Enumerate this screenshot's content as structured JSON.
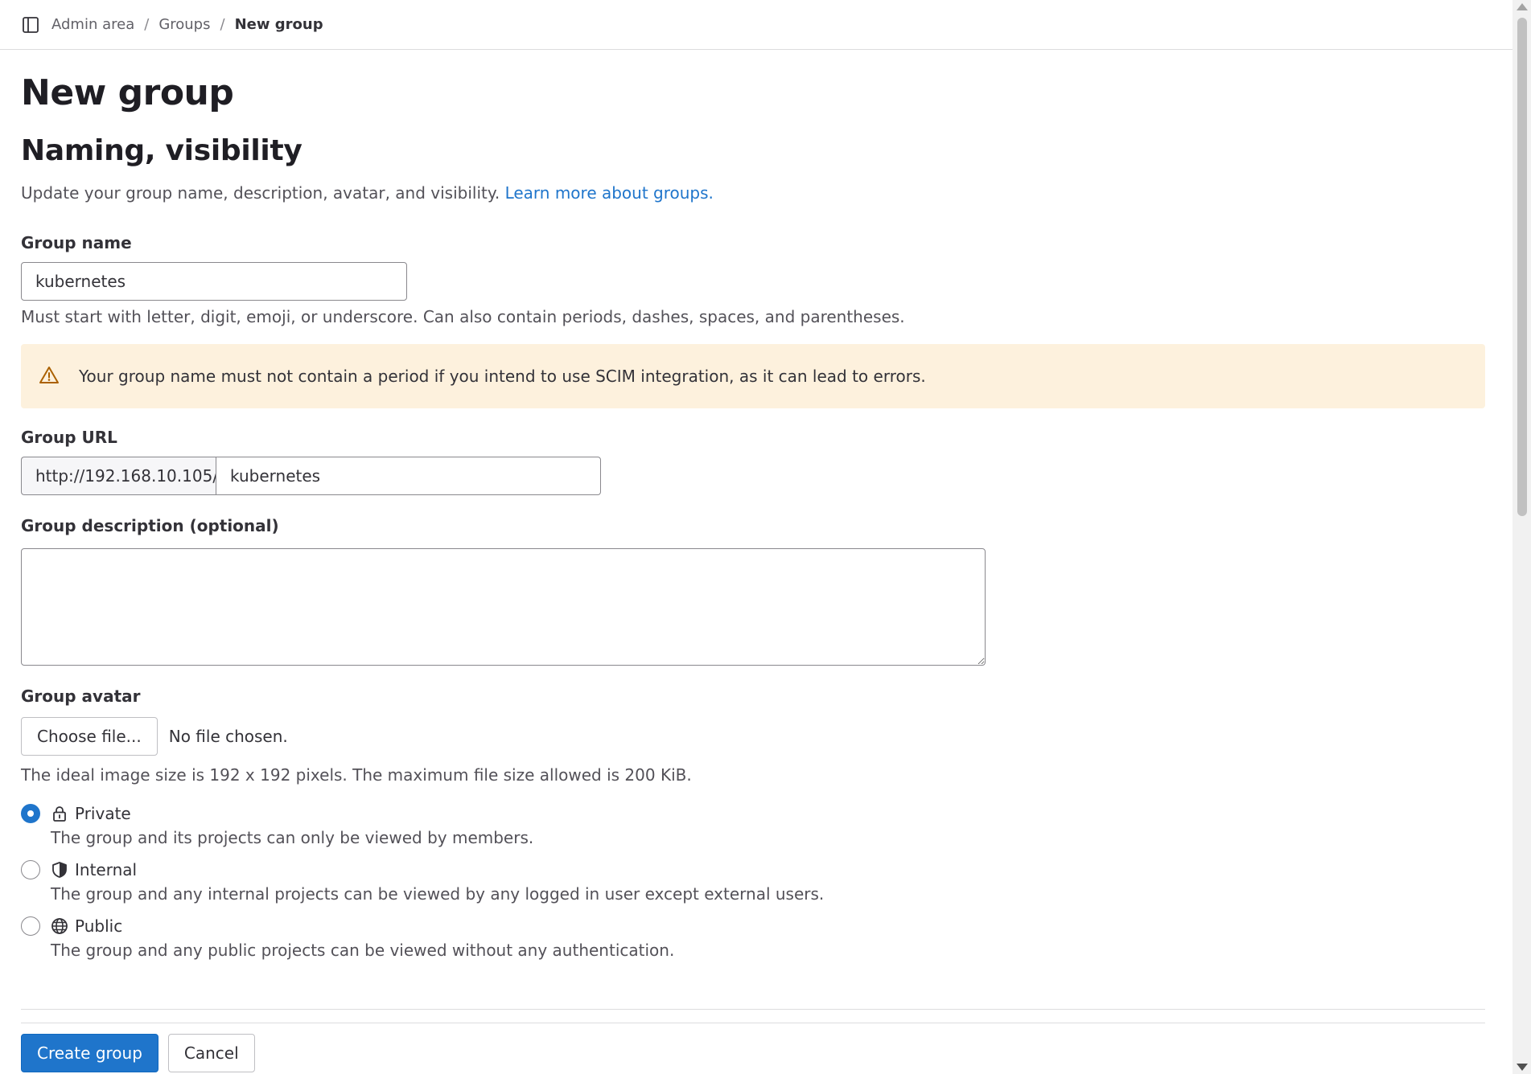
{
  "breadcrumb": {
    "items": [
      "Admin area",
      "Groups"
    ],
    "current": "New group",
    "separator": "/"
  },
  "page": {
    "title": "New group"
  },
  "section": {
    "title": "Naming, visibility",
    "description": "Update your group name, description, avatar, and visibility.",
    "learn_more_link": "Learn more about groups."
  },
  "group_name": {
    "label": "Group name",
    "value": "kubernetes",
    "help": "Must start with letter, digit, emoji, or underscore. Can also contain periods, dashes, spaces, and parentheses."
  },
  "alert": {
    "icon": "warning-icon",
    "text": "Your group name must not contain a period if you intend to use SCIM integration, as it can lead to errors."
  },
  "group_url": {
    "label": "Group URL",
    "prefix": "http://192.168.10.105/",
    "value": "kubernetes"
  },
  "description": {
    "label": "Group description (optional)",
    "value": ""
  },
  "avatar": {
    "label": "Group avatar",
    "button": "Choose file...",
    "status": "No file chosen.",
    "help": "The ideal image size is 192 x 192 pixels. The maximum file size allowed is 200 KiB."
  },
  "visibility": {
    "options": [
      {
        "label": "Private",
        "icon": "lock-icon",
        "help": "The group and its projects can only be viewed by members.",
        "checked": true
      },
      {
        "label": "Internal",
        "icon": "shield-icon",
        "help": "The group and any internal projects can be viewed by any logged in user except external users.",
        "checked": false
      },
      {
        "label": "Public",
        "icon": "globe-icon",
        "help": "The group and any public projects can be viewed without any authentication.",
        "checked": false
      }
    ]
  },
  "actions": {
    "create": "Create group",
    "cancel": "Cancel"
  },
  "colors": {
    "accent": "#1f75cb",
    "alert_bg": "#fdf1dd",
    "warning_icon": "#ab6100"
  }
}
